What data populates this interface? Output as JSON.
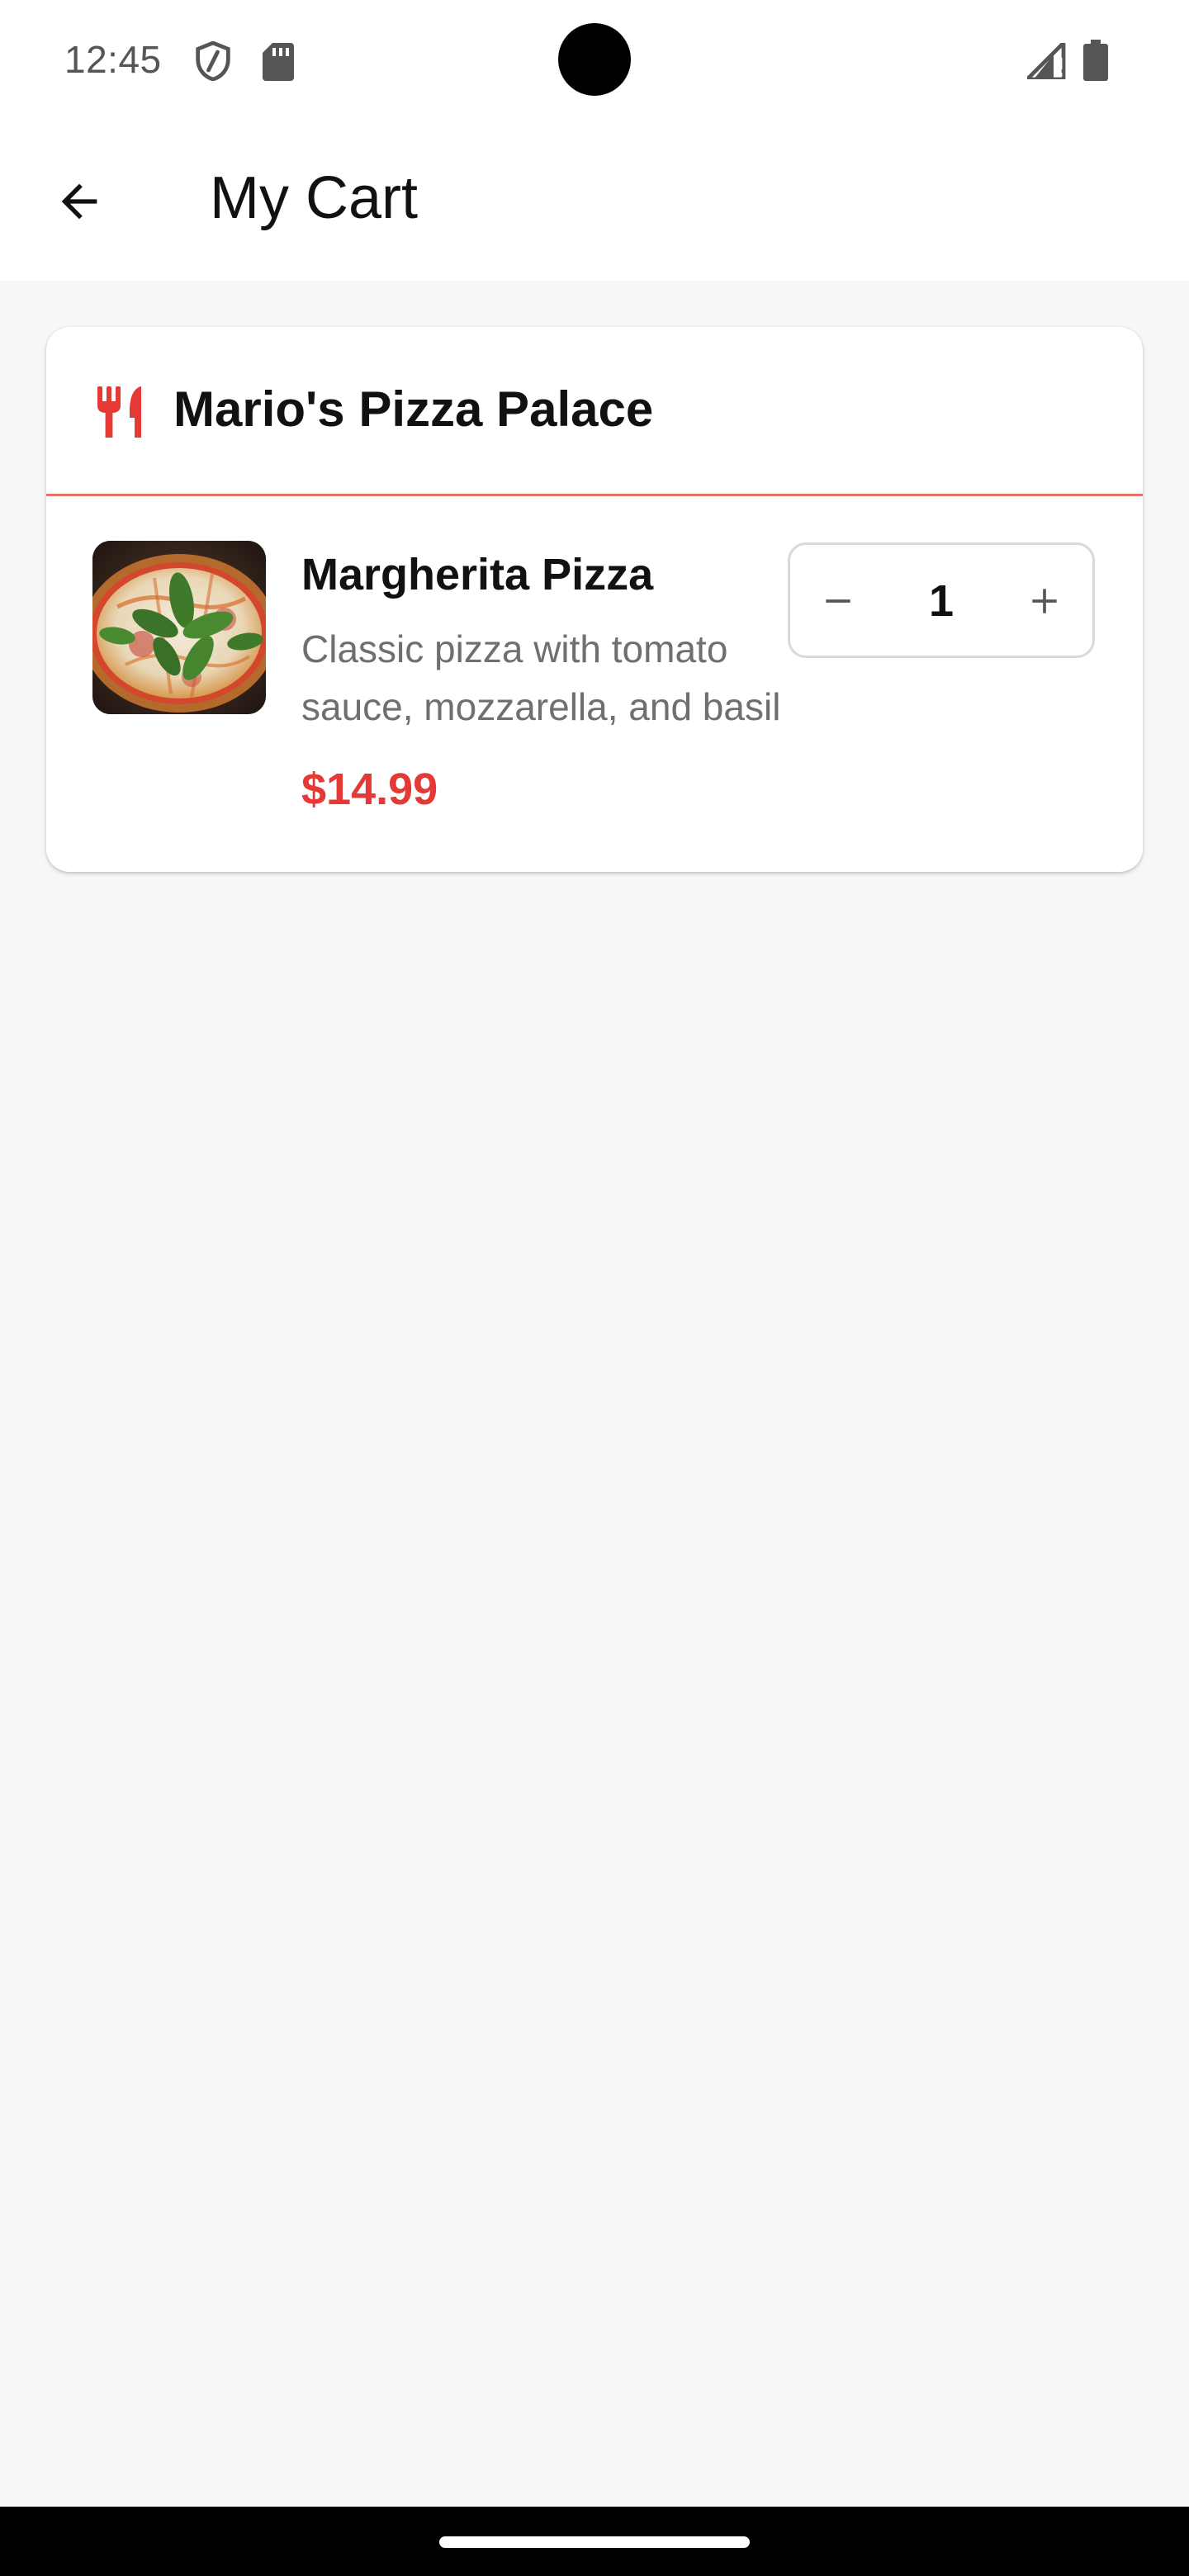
{
  "status_bar": {
    "time": "12:45",
    "left_icons": [
      "shield-icon",
      "sd-card-icon"
    ],
    "right_icons": [
      "signal-icon",
      "battery-icon"
    ]
  },
  "app_bar": {
    "back_icon": "arrow-back-icon",
    "title": "My Cart"
  },
  "cart": {
    "restaurant": {
      "icon": "utensils-icon",
      "name": "Mario's Pizza Palace"
    },
    "items": [
      {
        "image": "pizza-image",
        "name": "Margherita Pizza",
        "description": "Classic pizza with tomato sauce, mozzarella, and basil",
        "price": "$14.99",
        "quantity": "1"
      }
    ]
  },
  "colors": {
    "accent": "#e53935",
    "divider": "#e57368",
    "background": "#f6f7f9",
    "surface": "#ffffff",
    "muted_text": "#6f6f6f"
  }
}
